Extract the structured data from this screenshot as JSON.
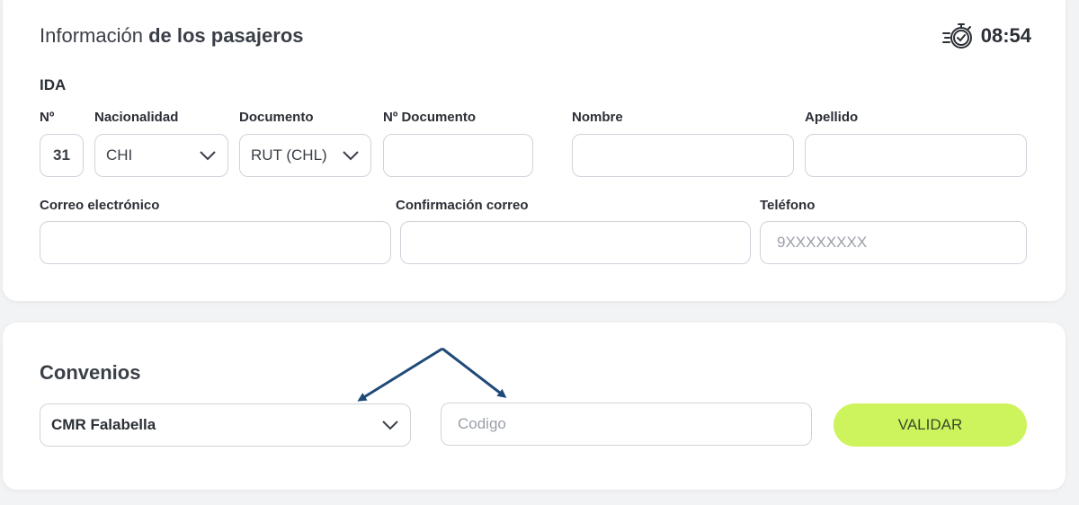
{
  "passengers": {
    "title_light": "Información",
    "title_bold": "de los pasajeros",
    "timer": "08:54",
    "trip_label": "IDA",
    "labels": {
      "number": "Nº",
      "nationality": "Nacionalidad",
      "document": "Documento",
      "document_number": "Nº Documento",
      "first_name": "Nombre",
      "last_name": "Apellido",
      "email": "Correo electrónico",
      "email_confirm": "Confirmación correo",
      "phone": "Teléfono"
    },
    "values": {
      "number": "31",
      "nationality": "CHI",
      "document": "RUT (CHL)",
      "document_number": "",
      "first_name": "",
      "last_name": "",
      "email": "",
      "email_confirm": ""
    },
    "placeholders": {
      "phone": "9XXXXXXXX"
    }
  },
  "convenios": {
    "title": "Convenios",
    "selected": "CMR Falabella",
    "code_placeholder": "Codigo",
    "validate_label": "VALIDAR"
  },
  "colors": {
    "accent": "#cdf35d",
    "arrow": "#1f4a78",
    "border": "#cfd3da"
  }
}
